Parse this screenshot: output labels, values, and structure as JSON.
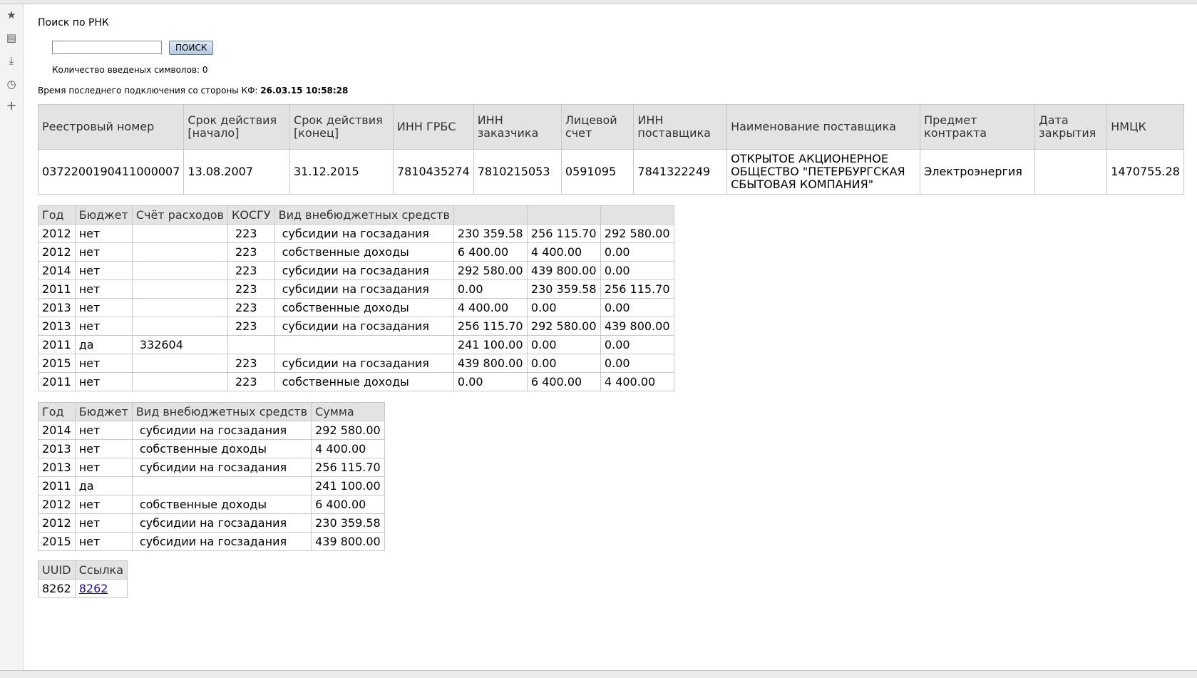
{
  "sidebar_icons": [
    "star-icon",
    "note-icon",
    "download-icon",
    "history-icon",
    "add-icon"
  ],
  "search": {
    "title": "Поиск по РНК",
    "input_value": "",
    "button_label": "ПОИСК",
    "count_text": "Количество введеных символов: 0"
  },
  "connection": {
    "label": "Время последнего подключения со стороны КФ:",
    "value": "26.03.15 10:58:28"
  },
  "contract_table": {
    "headers": [
      "Реестровый номер",
      "Срок действия [начало]",
      "Срок действия [конец]",
      "ИНН ГРБС",
      "ИНН заказчика",
      "Лицевой счет",
      "ИНН поставщика",
      "Наименование поставщика",
      "Предмет контракта",
      "Дата закрытия",
      "НМЦК"
    ],
    "row": [
      "0372200190411000007",
      "13.08.2007",
      "31.12.2015",
      "7810435274",
      "7810215053",
      "0591095",
      "7841322249",
      "ОТКРЫТОЕ АКЦИОНЕРНОЕ ОБЩЕСТВО \"ПЕТЕРБУРГСКАЯ СБЫТОВАЯ КОМПАНИЯ\"",
      "Электроэнергия",
      "",
      "1470755.28"
    ]
  },
  "finance_table": {
    "headers": [
      "Год",
      "Бюджет",
      "Счёт расходов",
      "КОСГУ",
      "Вид внебюджетных средств",
      "",
      "",
      ""
    ],
    "rows": [
      [
        "2012",
        "нет",
        "",
        "223",
        "субсидии на госзадания",
        "230 359.58",
        "256 115.70",
        "292 580.00"
      ],
      [
        "2012",
        "нет",
        "",
        "223",
        "собственные доходы",
        "6 400.00",
        "4 400.00",
        "0.00"
      ],
      [
        "2014",
        "нет",
        "",
        "223",
        "субсидии на госзадания",
        "292 580.00",
        "439 800.00",
        "0.00"
      ],
      [
        "2011",
        "нет",
        "",
        "223",
        "субсидии на госзадания",
        "0.00",
        "230 359.58",
        "256 115.70"
      ],
      [
        "2013",
        "нет",
        "",
        "223",
        "собственные доходы",
        "4 400.00",
        "0.00",
        "0.00"
      ],
      [
        "2013",
        "нет",
        "",
        "223",
        "субсидии на госзадания",
        "256 115.70",
        "292 580.00",
        "439 800.00"
      ],
      [
        "2011",
        "да",
        "332604",
        "",
        "",
        "241 100.00",
        "0.00",
        "0.00"
      ],
      [
        "2015",
        "нет",
        "",
        "223",
        "субсидии на госзадания",
        "439 800.00",
        "0.00",
        "0.00"
      ],
      [
        "2011",
        "нет",
        "",
        "223",
        "собственные доходы",
        "0.00",
        "6 400.00",
        "4 400.00"
      ]
    ]
  },
  "sum_table": {
    "headers": [
      "Год",
      "Бюджет",
      "Вид внебюджетных средств",
      "Сумма"
    ],
    "rows": [
      [
        "2014",
        "нет",
        "субсидии на госзадания",
        "292 580.00"
      ],
      [
        "2013",
        "нет",
        "собственные доходы",
        "4 400.00"
      ],
      [
        "2013",
        "нет",
        "субсидии на госзадания",
        "256 115.70"
      ],
      [
        "2011",
        "да",
        "",
        "241 100.00"
      ],
      [
        "2012",
        "нет",
        "собственные доходы",
        "6 400.00"
      ],
      [
        "2012",
        "нет",
        "субсидии на госзадания",
        "230 359.58"
      ],
      [
        "2015",
        "нет",
        "субсидии на госзадания",
        "439 800.00"
      ]
    ]
  },
  "uuid_table": {
    "headers": [
      "UUID",
      "Ссылка"
    ],
    "rows": [
      [
        "8262",
        "8262"
      ]
    ]
  }
}
